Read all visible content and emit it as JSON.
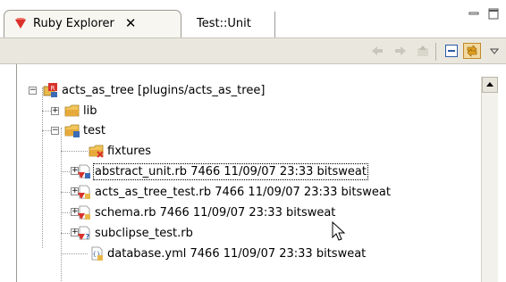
{
  "tabs": [
    {
      "label": "Ruby Explorer",
      "active": true
    },
    {
      "label": "Test::Unit",
      "active": false
    }
  ],
  "tree": {
    "root": "acts_as_tree [plugins/acts_as_tree]",
    "lib": "lib",
    "test": "test",
    "fixtures": "fixtures",
    "files": [
      {
        "label": "abstract_unit.rb 7466  11/09/07 23:33  bitsweat"
      },
      {
        "label": "acts_as_tree_test.rb 7466  11/09/07 23:33  bitsweat"
      },
      {
        "label": "schema.rb 7466  11/09/07 23:33  bitsweat"
      },
      {
        "label": "subclipse_test.rb"
      },
      {
        "label": "database.yml 7466  11/09/07 23:33  bitsweat"
      }
    ]
  },
  "colors": {
    "accent": "#d9312b",
    "folder": "#e8b84a",
    "toolbar_bg": "#eae8de"
  },
  "icons": [
    "ruby-gem-icon",
    "close-icon",
    "minimize-icon",
    "maximize-icon",
    "back-arrow-icon",
    "forward-arrow-icon",
    "up-folder-icon",
    "collapse-all-icon",
    "link-editor-icon",
    "view-menu-icon",
    "project-icon",
    "folder-icon",
    "ruby-file-icon",
    "yaml-file-icon",
    "mouse-cursor-icon"
  ]
}
